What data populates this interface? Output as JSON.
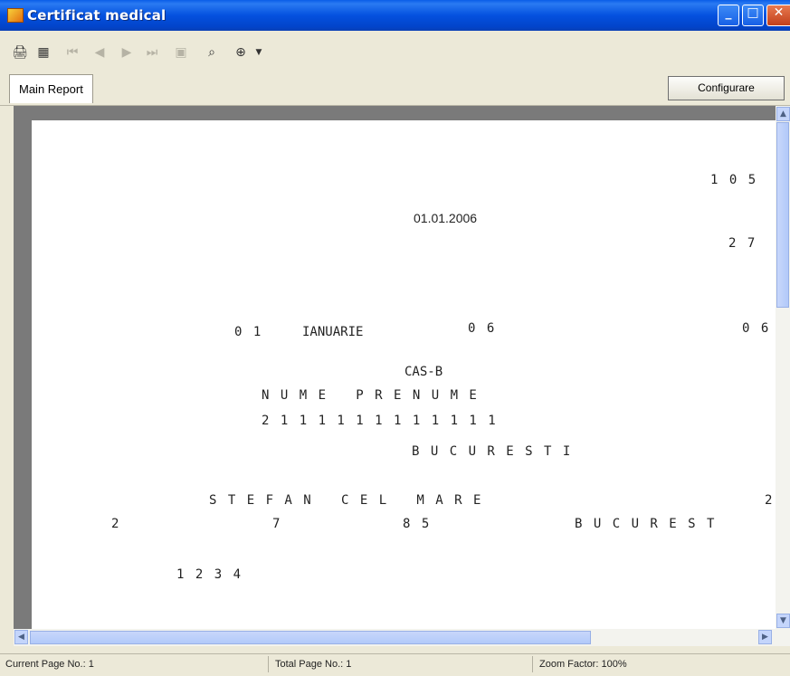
{
  "window": {
    "title": "Certificat medical"
  },
  "toolbar": {
    "icons": [
      "print-icon",
      "tree-toggle-icon",
      "first-page-icon",
      "prev-page-icon",
      "next-page-icon",
      "last-page-icon",
      "goto-page-icon",
      "find-icon",
      "zoom-icon"
    ]
  },
  "tabs": {
    "main": "Main Report"
  },
  "configure_button": "Configurare",
  "report": {
    "num_top": "1 0 5",
    "date": "01.01.2006",
    "num_2_7": "2 7",
    "day": "0 1",
    "month": "IANUARIE",
    "year_short": "0 6",
    "num_06_right": "0 6",
    "cas": "CAS-B",
    "name": "N U M E   P R E N U M E",
    "cnp": "2 1 1 1 1 1 1 1 1 1 1 1 1",
    "city": "B U C U R E S T I",
    "street": "S T E F A N   C E L   M A R E",
    "street_no_right": "2",
    "addr_a": "2",
    "addr_b": "7",
    "addr_c": "8 5",
    "city2": "B U C U R E S T",
    "code": "1 2 3 4"
  },
  "status": {
    "current_page": "Current Page No.: 1",
    "total_page": "Total Page No.: 1",
    "zoom": "Zoom Factor: 100%"
  }
}
